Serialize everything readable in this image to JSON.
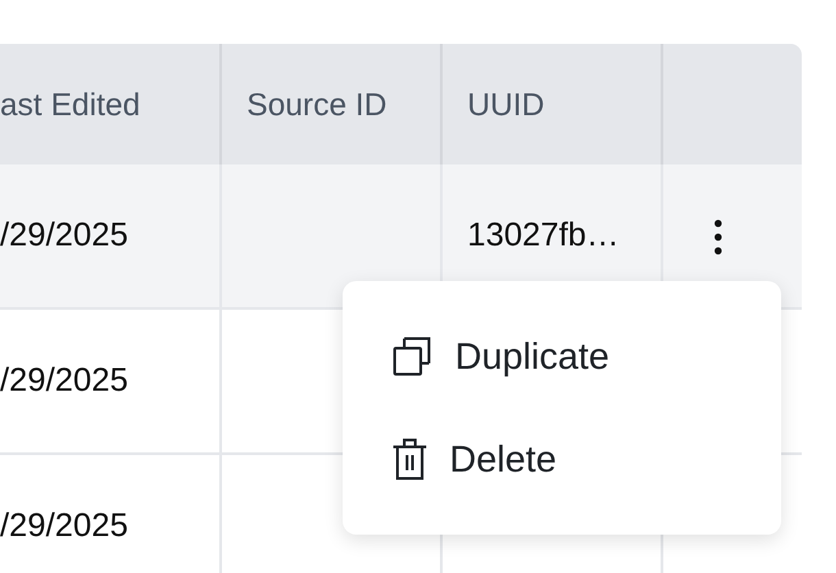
{
  "table": {
    "columns": [
      {
        "label": "ast Edited"
      },
      {
        "label": "Source ID"
      },
      {
        "label": "UUID"
      }
    ],
    "rows": [
      {
        "last_edited": "/29/2025",
        "uuid": "13027fb…",
        "highlighted": true,
        "actions_button": true
      },
      {
        "last_edited": "/29/2025",
        "highlighted": false
      },
      {
        "last_edited": "/29/2025",
        "highlighted": false
      }
    ]
  },
  "menu": {
    "items": [
      {
        "kind": "duplicate",
        "label": "Duplicate"
      },
      {
        "kind": "delete",
        "label": "Delete"
      }
    ]
  }
}
